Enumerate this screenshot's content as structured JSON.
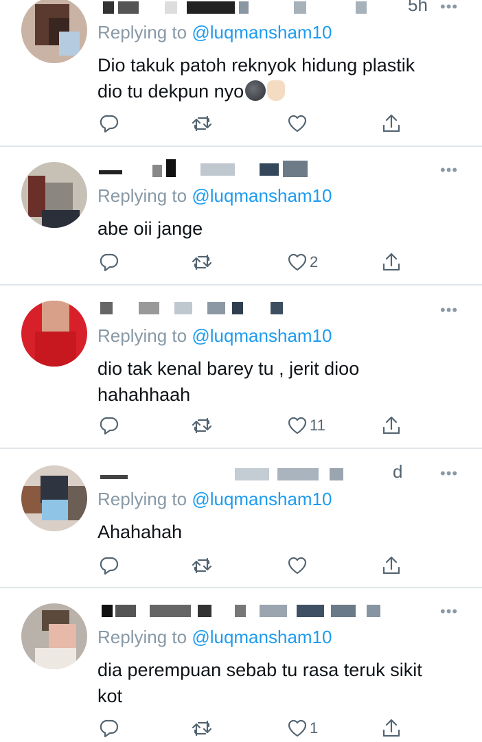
{
  "replying_prefix": "Replying to",
  "tweets": [
    {
      "header_tail": "5h",
      "handle": "@luqmansham10",
      "body_lines": [
        "Dio takuk patoh reknyok hidung plastik",
        "dio tu dekpun nyo"
      ],
      "likes": ""
    },
    {
      "header_tail": "",
      "handle": "@luqmansham10",
      "body_lines": [
        "abe oii jange"
      ],
      "likes": "2"
    },
    {
      "header_tail": "",
      "handle": "@luqmansham10",
      "body_lines": [
        "dio tak kenal barey tu , jerit dioo",
        "hahahhaah"
      ],
      "likes": "11"
    },
    {
      "header_tail": "d",
      "handle": "@luqmansham10",
      "body_lines": [
        "Ahahahah"
      ],
      "likes": ""
    },
    {
      "header_tail": "",
      "handle": "@luqmansham10",
      "body_lines": [
        "dia perempuan sebab tu rasa teruk sikit",
        "kot"
      ],
      "likes": "1"
    }
  ],
  "colors": {
    "handle": "#1d9bf0",
    "muted": "#8899a6",
    "icon": "#536471",
    "divider": "#e1e6ea"
  },
  "icons": [
    "reply-icon",
    "retweet-icon",
    "like-icon",
    "share-icon",
    "more-icon",
    "dark-moon-emoji",
    "raised-hand-emoji"
  ]
}
